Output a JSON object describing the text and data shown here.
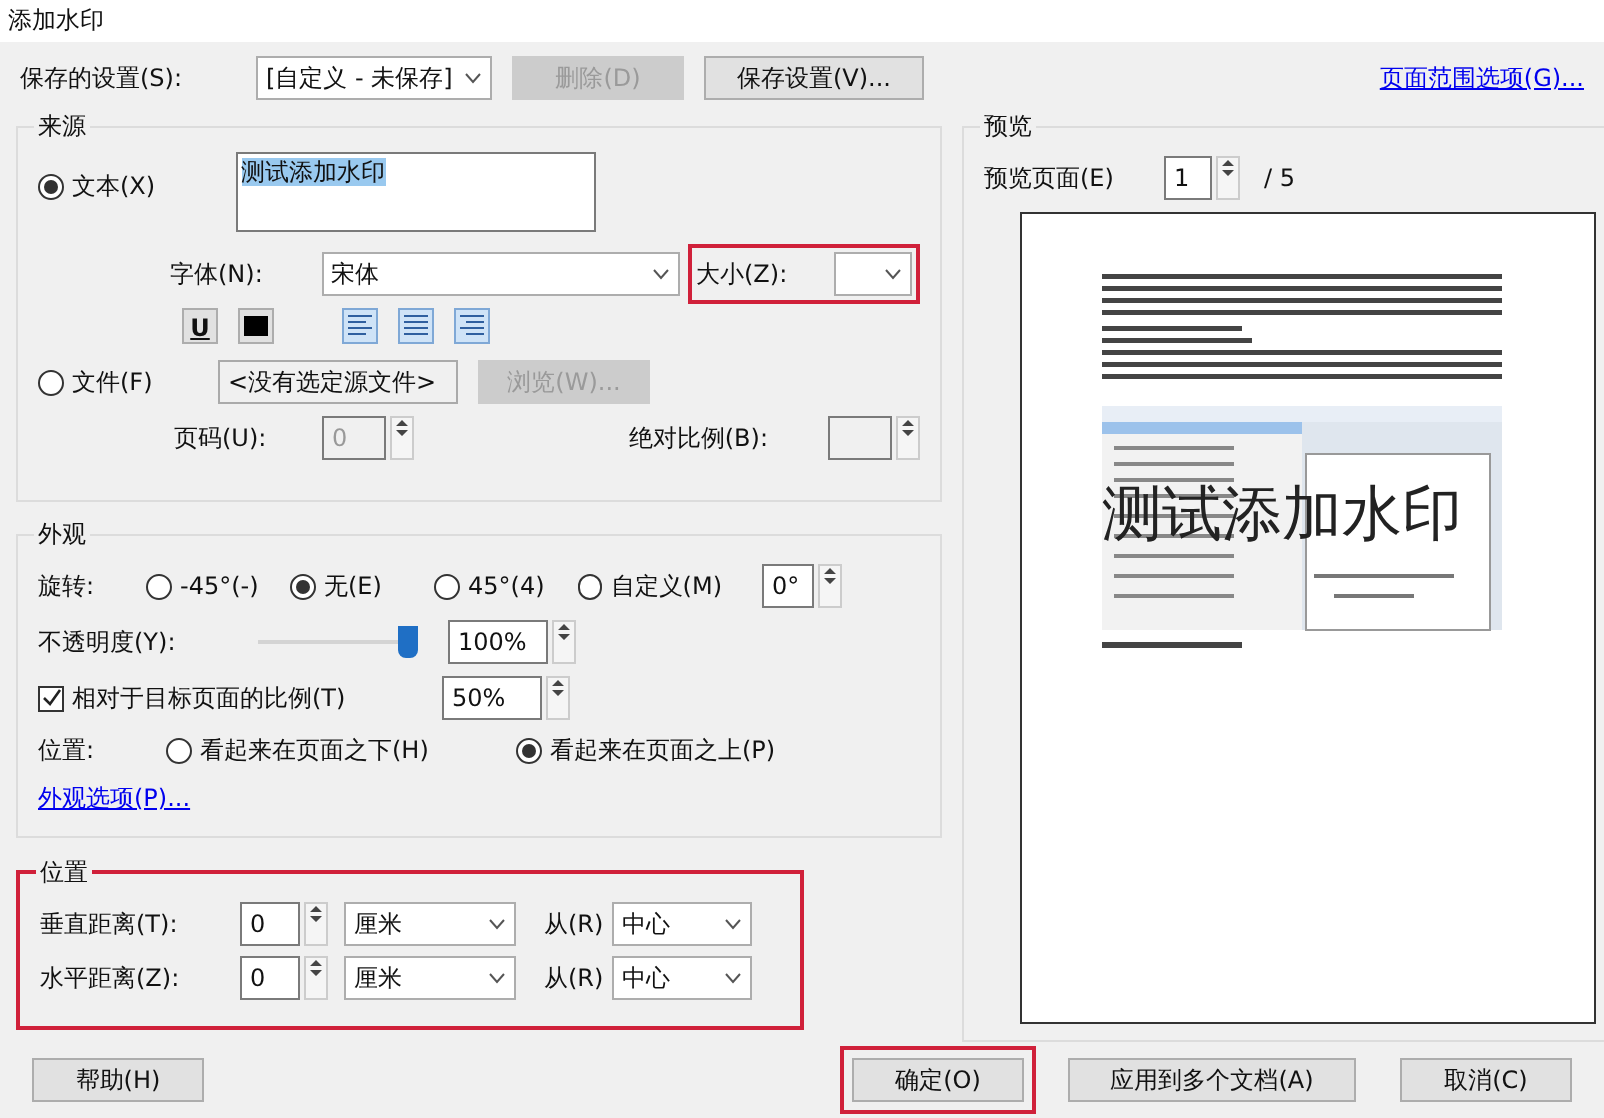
{
  "window": {
    "title": "添加水印"
  },
  "saved_settings": {
    "label": "保存的设置(S):",
    "value": "[自定义 - 未保存]",
    "delete_button": {
      "label": "删除(D)",
      "disabled": true
    },
    "save_button": {
      "label": "保存设置(V)...",
      "disabled": false
    },
    "page_range_link": "页面范围选项(G)..."
  },
  "source": {
    "title": "来源",
    "text_option": {
      "label": "文本(X)",
      "selected": true
    },
    "text_value": "测试添加水印",
    "font_label": "字体(N):",
    "font_value": "宋体",
    "size_label": "大小(Z):",
    "size_highlighted": true,
    "underline_button": "U",
    "file_option": {
      "label": "文件(F)",
      "selected": false
    },
    "file_path": "<没有选定源文件>",
    "browse_button": {
      "label": "浏览(W)...",
      "disabled": true
    },
    "page_label": "页码(U):",
    "page_value": "0",
    "scale_label": "绝对比例(B):"
  },
  "appearance": {
    "title": "外观",
    "rotation_label": "旋转:",
    "rotation_options": [
      {
        "label": "-45°(-)",
        "selected": false
      },
      {
        "label": "无(E)",
        "selected": true
      },
      {
        "label": "45°(4)",
        "selected": false
      },
      {
        "label": "自定义(M)",
        "selected": false
      }
    ],
    "rotation_value": "0°",
    "opacity_label": "不透明度(Y):",
    "opacity": {
      "level": 1.0
    },
    "opacity_value": "100%",
    "relative_scale": {
      "label": "相对于目标页面的比例(T)",
      "checked": true,
      "value": "50%"
    },
    "position_label": "位置:",
    "position_options": [
      {
        "label": "看起来在页面之下(H)",
        "selected": false
      },
      {
        "label": "看起来在页面之上(P)",
        "selected": true
      }
    ],
    "options_link": "外观选项(P)..."
  },
  "position": {
    "title": "位置",
    "highlighted": true,
    "rows": [
      {
        "label": "垂直距离(T):",
        "value": "0",
        "unit": "厘米",
        "from_label": "从(R)",
        "from_value": "中心"
      },
      {
        "label": "水平距离(Z):",
        "value": "0",
        "unit": "厘米",
        "from_label": "从(R)",
        "from_value": "中心"
      }
    ]
  },
  "preview": {
    "title": "预览",
    "page_label": "预览页面(E)",
    "page_value": "1",
    "page_total": "/ 5",
    "watermark_text": "测试添加水印"
  },
  "buttons": [
    {
      "label": "帮助(H)",
      "highlighted": false
    },
    {
      "label": "确定(O)",
      "highlighted": true
    },
    {
      "label": "应用到多个文档(A)",
      "highlighted": false
    },
    {
      "label": "取消(C)",
      "highlighted": false
    }
  ]
}
